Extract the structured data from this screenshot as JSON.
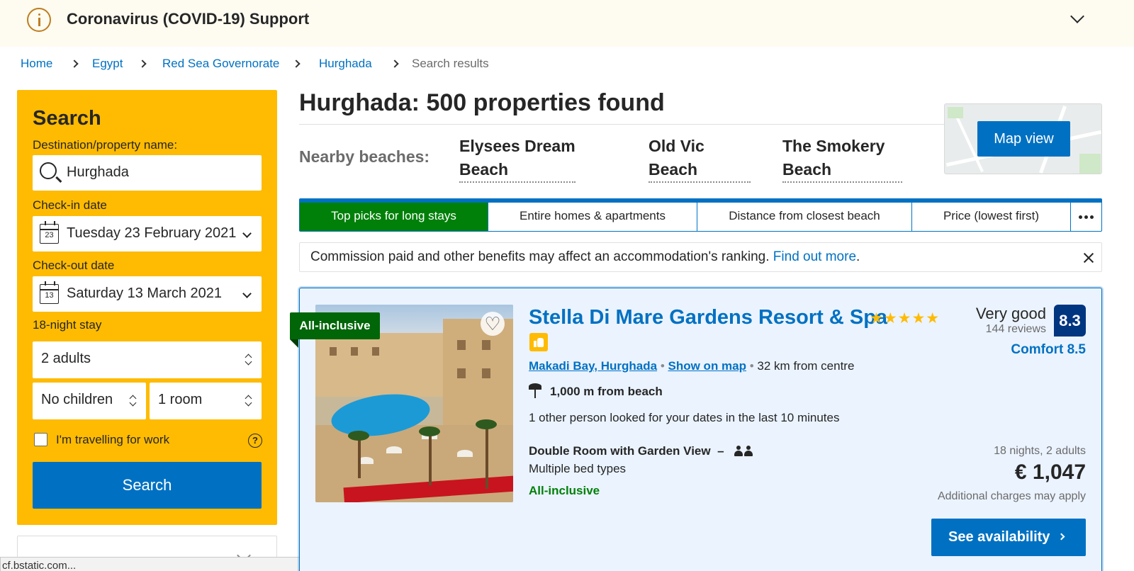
{
  "covid": {
    "title": "Coronavirus (COVID-19) Support"
  },
  "breadcrumb": [
    "Home",
    "Egypt",
    "Red Sea Governorate",
    "Hurghada",
    "Search results"
  ],
  "search": {
    "title": "Search",
    "destination_label": "Destination/property name:",
    "destination_value": "Hurghada",
    "checkin_label": "Check-in date",
    "checkin_value": "Tuesday 23 February 2021",
    "checkin_day": "23",
    "checkout_label": "Check-out date",
    "checkout_value": "Saturday 13 March 2021",
    "checkout_day": "13",
    "stay_label": "18-night stay",
    "adults": "2 adults",
    "children": "No children",
    "rooms": "1 room",
    "work_label": "I'm travelling for work",
    "work_checked": false,
    "button_label": "Search",
    "help_glyph": "?"
  },
  "status_bar": {
    "url": "cf.bstatic.com..."
  },
  "main": {
    "title": "Hurghada: 500 properties found",
    "nearby_label": "Nearby beaches:",
    "beaches": [
      {
        "line1": "Elysees Dream",
        "line2": "Beach"
      },
      {
        "line1": "Old Vic",
        "line2": "Beach"
      },
      {
        "line1": "The Smokery",
        "line2": "Beach"
      }
    ],
    "map_button": "Map view"
  },
  "sort": {
    "tabs": [
      "Top picks for long stays",
      "Entire homes & apartments",
      "Distance from closest beach",
      "Price (lowest first)"
    ],
    "active_index": 0,
    "more_icon": "more-dots-icon"
  },
  "notice": {
    "text": "Commission paid and other benefits may affect an accommodation's ranking. ",
    "link": "Find out more",
    "end": "."
  },
  "property": {
    "badge": "All-inclusive",
    "name": "Stella Di Mare Gardens Resort & Spa",
    "stars": "★★★★★",
    "star_count": 5,
    "location_link": "Makadi Bay, Hurghada",
    "map_link": "Show on map",
    "distance": "32 km from centre",
    "beach_distance": "1,000 m from beach",
    "looked": "1 other person looked for your dates in the last 10 minutes",
    "room_name": "Double Room with Garden View",
    "room_dash": "–",
    "bed_types": "Multiple bed types",
    "meal": "All-inclusive",
    "score_text": "Very good",
    "reviews": "144 reviews",
    "score": "8.3",
    "comfort": "Comfort 8.5",
    "nights": "18 nights, 2 adults",
    "price": "€ 1,047",
    "charges": "Additional charges may apply",
    "cta": "See availability",
    "heart_glyph": "♡"
  },
  "colors": {
    "brand_blue": "#0071c2",
    "brand_yellow": "#febb02",
    "green": "#008009",
    "dark_blue": "#003580"
  }
}
